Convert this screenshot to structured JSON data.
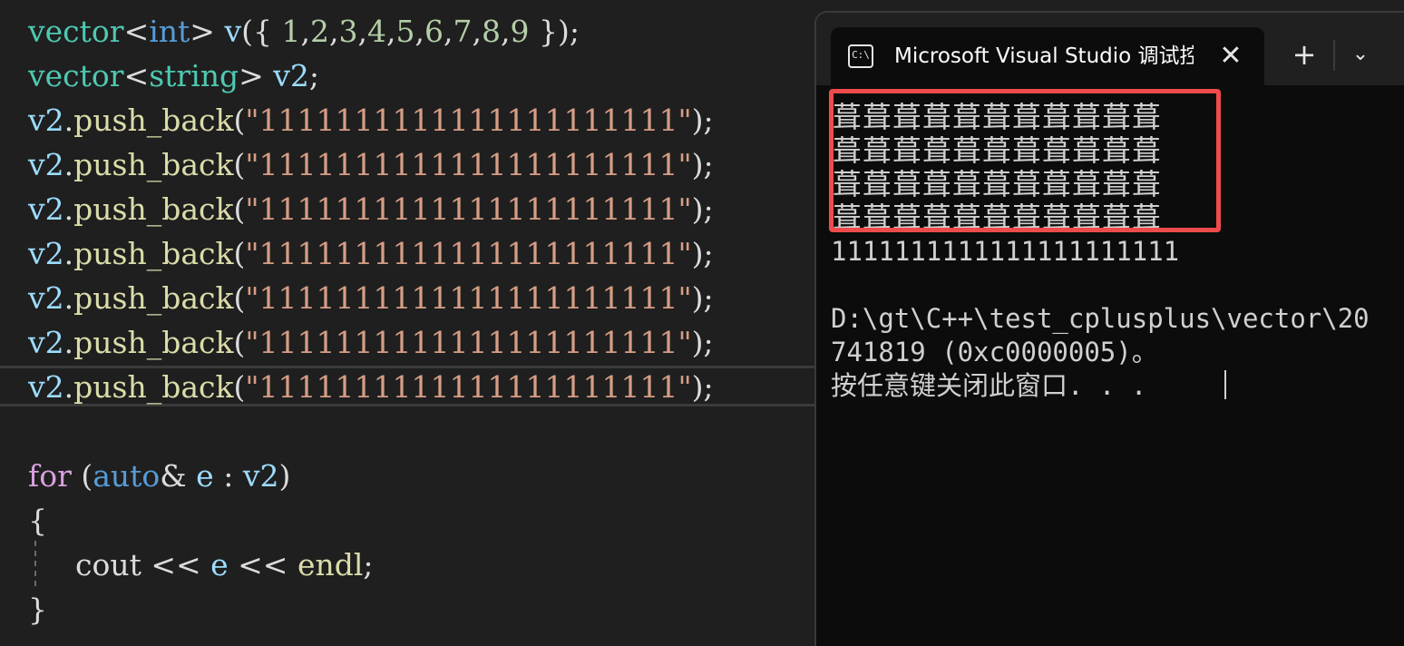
{
  "editor": {
    "lines": [
      {
        "name": "line-vector-int",
        "tokens": [
          {
            "t": "vector",
            "c": "type"
          },
          {
            "t": "<",
            "c": "punc"
          },
          {
            "t": "int",
            "c": "blue"
          },
          {
            "t": "> ",
            "c": "punc"
          },
          {
            "t": "v",
            "c": "var"
          },
          {
            "t": "({ ",
            "c": "punc"
          },
          {
            "t": "1",
            "c": "num"
          },
          {
            "t": ",",
            "c": "punc"
          },
          {
            "t": "2",
            "c": "num"
          },
          {
            "t": ",",
            "c": "punc"
          },
          {
            "t": "3",
            "c": "num"
          },
          {
            "t": ",",
            "c": "punc"
          },
          {
            "t": "4",
            "c": "num"
          },
          {
            "t": ",",
            "c": "punc"
          },
          {
            "t": "5",
            "c": "num"
          },
          {
            "t": ",",
            "c": "punc"
          },
          {
            "t": "6",
            "c": "num"
          },
          {
            "t": ",",
            "c": "punc"
          },
          {
            "t": "7",
            "c": "num"
          },
          {
            "t": ",",
            "c": "punc"
          },
          {
            "t": "8",
            "c": "num"
          },
          {
            "t": ",",
            "c": "punc"
          },
          {
            "t": "9",
            "c": "num"
          },
          {
            "t": " });",
            "c": "punc"
          }
        ]
      },
      {
        "name": "line-vector-string",
        "tokens": [
          {
            "t": "vector",
            "c": "type"
          },
          {
            "t": "<",
            "c": "punc"
          },
          {
            "t": "string",
            "c": "type"
          },
          {
            "t": "> ",
            "c": "punc"
          },
          {
            "t": "v2",
            "c": "var"
          },
          {
            "t": ";",
            "c": "punc"
          }
        ]
      },
      {
        "name": "line-push-back-1",
        "tokens": [
          {
            "t": "v2",
            "c": "var"
          },
          {
            "t": ".",
            "c": "punc"
          },
          {
            "t": "push_back",
            "c": "fn"
          },
          {
            "t": "(",
            "c": "punc"
          },
          {
            "t": "\"1111111111111111111111\"",
            "c": "str"
          },
          {
            "t": ");",
            "c": "punc"
          }
        ]
      },
      {
        "name": "line-push-back-2",
        "tokens": [
          {
            "t": "v2",
            "c": "var"
          },
          {
            "t": ".",
            "c": "punc"
          },
          {
            "t": "push_back",
            "c": "fn"
          },
          {
            "t": "(",
            "c": "punc"
          },
          {
            "t": "\"1111111111111111111111\"",
            "c": "str"
          },
          {
            "t": ");",
            "c": "punc"
          }
        ]
      },
      {
        "name": "line-push-back-3",
        "tokens": [
          {
            "t": "v2",
            "c": "var"
          },
          {
            "t": ".",
            "c": "punc"
          },
          {
            "t": "push_back",
            "c": "fn"
          },
          {
            "t": "(",
            "c": "punc"
          },
          {
            "t": "\"1111111111111111111111\"",
            "c": "str"
          },
          {
            "t": ");",
            "c": "punc"
          }
        ]
      },
      {
        "name": "line-push-back-4",
        "tokens": [
          {
            "t": "v2",
            "c": "var"
          },
          {
            "t": ".",
            "c": "punc"
          },
          {
            "t": "push_back",
            "c": "fn"
          },
          {
            "t": "(",
            "c": "punc"
          },
          {
            "t": "\"1111111111111111111111\"",
            "c": "str"
          },
          {
            "t": ");",
            "c": "punc"
          }
        ]
      },
      {
        "name": "line-push-back-5",
        "tokens": [
          {
            "t": "v2",
            "c": "var"
          },
          {
            "t": ".",
            "c": "punc"
          },
          {
            "t": "push_back",
            "c": "fn"
          },
          {
            "t": "(",
            "c": "punc"
          },
          {
            "t": "\"1111111111111111111111\"",
            "c": "str"
          },
          {
            "t": ");",
            "c": "punc"
          }
        ]
      },
      {
        "name": "line-push-back-6",
        "tokens": [
          {
            "t": "v2",
            "c": "var"
          },
          {
            "t": ".",
            "c": "punc"
          },
          {
            "t": "push_back",
            "c": "fn"
          },
          {
            "t": "(",
            "c": "punc"
          },
          {
            "t": "\"1111111111111111111111\"",
            "c": "str"
          },
          {
            "t": ");",
            "c": "punc"
          }
        ]
      },
      {
        "name": "line-push-back-7",
        "tokens": [
          {
            "t": "v2",
            "c": "var"
          },
          {
            "t": ".",
            "c": "punc"
          },
          {
            "t": "push_back",
            "c": "fn"
          },
          {
            "t": "(",
            "c": "punc"
          },
          {
            "t": "\"1111111111111111111111\"",
            "c": "str"
          },
          {
            "t": ");",
            "c": "punc"
          }
        ]
      },
      {
        "name": "line-blank",
        "tokens": []
      },
      {
        "name": "line-for",
        "tokens": [
          {
            "t": "for",
            "c": "ctrl"
          },
          {
            "t": " (",
            "c": "punc"
          },
          {
            "t": "auto",
            "c": "blue"
          },
          {
            "t": "& ",
            "c": "punc"
          },
          {
            "t": "e",
            "c": "var"
          },
          {
            "t": " : ",
            "c": "punc"
          },
          {
            "t": "v2",
            "c": "var"
          },
          {
            "t": ")",
            "c": "punc"
          }
        ]
      },
      {
        "name": "line-open-brace",
        "tokens": [
          {
            "t": "{",
            "c": "punc"
          }
        ]
      },
      {
        "name": "line-cout",
        "tokens": [
          {
            "t": "  cout",
            "c": "punc"
          },
          {
            "t": " << ",
            "c": "punc"
          },
          {
            "t": "e",
            "c": "var"
          },
          {
            "t": " << ",
            "c": "punc"
          },
          {
            "t": "endl",
            "c": "fn"
          },
          {
            "t": ";",
            "c": "punc"
          }
        ]
      },
      {
        "name": "line-close-brace",
        "tokens": [
          {
            "t": "}",
            "c": "punc"
          }
        ]
      }
    ]
  },
  "terminal": {
    "tab_title": "Microsoft Visual Studio 调试控制台",
    "tab_icon_text": "C:\\",
    "close_glyph": "✕",
    "new_tab_glyph": "+",
    "dropdown_glyph": "⌄",
    "garbled_lines": [
      "葺葺葺葺葺葺葺葺葺葺葺",
      "葺葺葺葺葺葺葺葺葺葺葺",
      "葺葺葺葺葺葺葺葺葺葺葺",
      "葺葺葺葺葺葺葺葺葺葺葺"
    ],
    "output_line": "1111111111111111111111",
    "exit_line_1": "D:\\gt\\C++\\test_cplusplus\\vector\\20",
    "exit_line_2": "741819 (0xc0000005)。",
    "prompt_line": "按任意键关闭此窗口. . ."
  },
  "colors": {
    "type": "#4ec9b0",
    "var": "#9cdcfe",
    "fn": "#dcdcaa",
    "str": "#d69d85",
    "ctrl": "#d8a0df",
    "blue": "#569cd6",
    "num": "#b5cea8",
    "punc": "#dcdcdc",
    "highlight": "#ef4b4b"
  }
}
